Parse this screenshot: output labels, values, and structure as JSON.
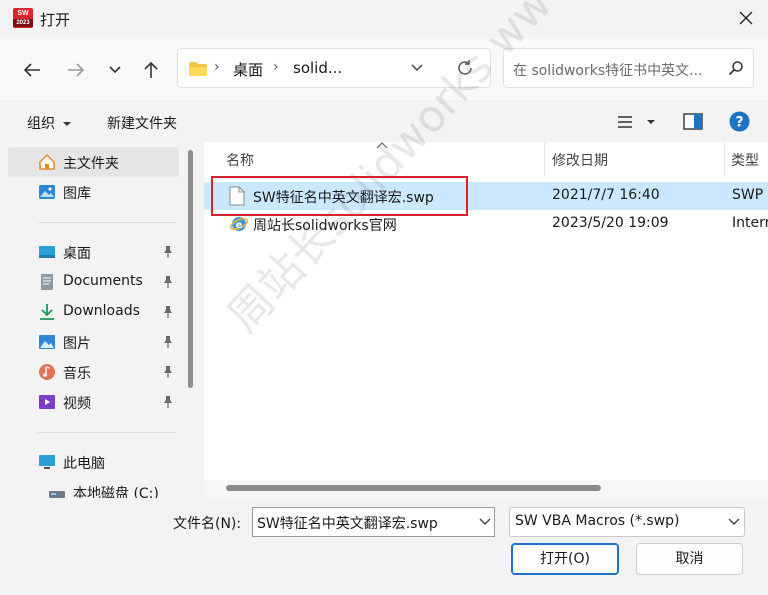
{
  "window": {
    "title": "打开",
    "app_icon_text": "SW",
    "app_icon_year": "2023"
  },
  "navigation": {
    "breadcrumbs": [
      "桌面",
      "solid..."
    ],
    "search_placeholder": "在 solidworks特征书中英文..."
  },
  "toolbar": {
    "organize": "组织",
    "new_folder": "新建文件夹"
  },
  "sidebar": {
    "items": [
      {
        "label": "主文件夹",
        "icon": "home-icon",
        "pinned": false,
        "selected": true
      },
      {
        "label": "图库",
        "icon": "gallery-icon",
        "pinned": false
      },
      {
        "label": "桌面",
        "icon": "desktop-icon",
        "pinned": true
      },
      {
        "label": "Documents",
        "icon": "documents-icon",
        "pinned": true
      },
      {
        "label": "Downloads",
        "icon": "downloads-icon",
        "pinned": true
      },
      {
        "label": "图片",
        "icon": "pictures-icon",
        "pinned": true
      },
      {
        "label": "音乐",
        "icon": "music-icon",
        "pinned": true
      },
      {
        "label": "视频",
        "icon": "videos-icon",
        "pinned": true
      },
      {
        "label": "此电脑",
        "icon": "computer-icon",
        "pinned": false
      },
      {
        "label": "本地磁盘 (C:)",
        "icon": "drive-icon",
        "pinned": false
      }
    ]
  },
  "file_list": {
    "columns": [
      "名称",
      "修改日期",
      "类型"
    ],
    "rows": [
      {
        "name": "SW特征名中英文翻译宏.swp",
        "modified": "2021/7/7 16:40",
        "type": "SWP",
        "icon": "file-icon",
        "selected": true
      },
      {
        "name": "周站长solidworks官网",
        "modified": "2023/5/20 19:09",
        "type": "Interr",
        "icon": "internet-shortcut-icon",
        "selected": false
      }
    ]
  },
  "watermark": "周站长solidworks  www.zzzsolidworks.com",
  "footer": {
    "filename_label": "文件名(N):",
    "filename_value": "SW特征名中英文翻译宏.swp",
    "filetype_value": "SW VBA Macros (*.swp)",
    "open_button": "打开(O)",
    "cancel_button": "取消"
  },
  "colors": {
    "accent": "#1a73c7",
    "selection": "#cce8ff",
    "highlight_box": "#d9232b",
    "help": "#1a73c7"
  }
}
